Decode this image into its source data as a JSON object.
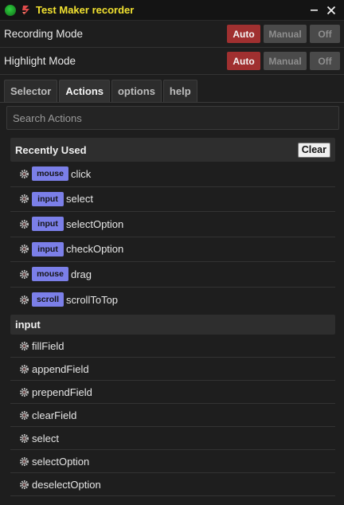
{
  "window": {
    "title": "Test Maker recorder",
    "minimize_label": "–",
    "close_label": "✕"
  },
  "modes": [
    {
      "label": "Recording Mode",
      "options": [
        "Auto",
        "Manual",
        "Off"
      ],
      "selected": "Auto"
    },
    {
      "label": "Highlight Mode",
      "options": [
        "Auto",
        "Manual",
        "Off"
      ],
      "selected": "Auto"
    }
  ],
  "tabs": [
    {
      "label": "Selector",
      "active": false
    },
    {
      "label": "Actions",
      "active": true
    },
    {
      "label": "options",
      "active": false
    },
    {
      "label": "help",
      "active": false
    }
  ],
  "search": {
    "placeholder": "Search Actions",
    "value": ""
  },
  "recently_used": {
    "title": "Recently Used",
    "clear_label": "Clear",
    "items": [
      {
        "badge": "mouse",
        "label": "click"
      },
      {
        "badge": "input",
        "label": "select"
      },
      {
        "badge": "input",
        "label": "selectOption"
      },
      {
        "badge": "input",
        "label": "checkOption"
      },
      {
        "badge": "mouse",
        "label": "drag"
      },
      {
        "badge": "scroll",
        "label": "scrollToTop"
      }
    ]
  },
  "input_section": {
    "title": "input",
    "items": [
      {
        "label": "fillField"
      },
      {
        "label": "appendField"
      },
      {
        "label": "prependField"
      },
      {
        "label": "clearField"
      },
      {
        "label": "select"
      },
      {
        "label": "selectOption"
      },
      {
        "label": "deselectOption"
      }
    ]
  },
  "colors": {
    "accent_title": "#f1e130",
    "auto_active": "#a03030",
    "badge": "#7b7fe8",
    "status_dot": "#1e9a2a"
  },
  "icons": {
    "status": "status-dot-icon",
    "logo": "app-logo-icon",
    "item": "gear-icon"
  }
}
